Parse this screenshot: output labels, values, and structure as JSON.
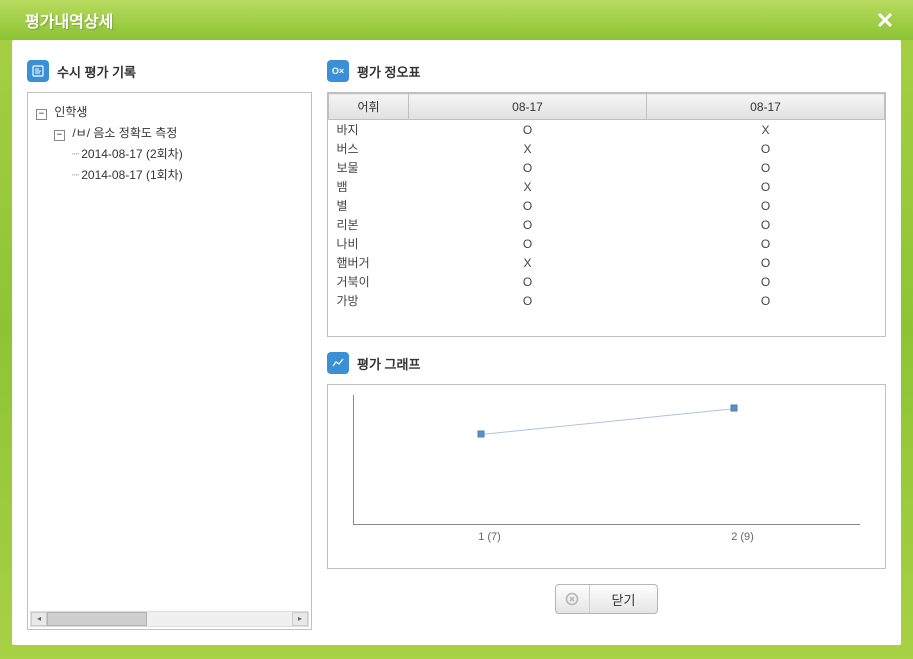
{
  "window": {
    "title": "평가내역상세"
  },
  "left": {
    "header": "수시 평가 기록",
    "tree": {
      "root_label": "인학생",
      "child_label": "/ㅂ/ 음소 정확도 측정",
      "leaves": [
        "2014-08-17 (2회차)",
        "2014-08-17 (1회차)"
      ]
    }
  },
  "right": {
    "table_header": "평가 정오표",
    "table": {
      "col0": "어휘",
      "col1": "08-17",
      "col2": "08-17",
      "rows": [
        {
          "w": "바지",
          "c1": "O",
          "c2": "X"
        },
        {
          "w": "버스",
          "c1": "X",
          "c2": "O"
        },
        {
          "w": "보물",
          "c1": "O",
          "c2": "O"
        },
        {
          "w": "뱀",
          "c1": "X",
          "c2": "O"
        },
        {
          "w": "별",
          "c1": "O",
          "c2": "O"
        },
        {
          "w": "리본",
          "c1": "O",
          "c2": "O"
        },
        {
          "w": "나비",
          "c1": "O",
          "c2": "O"
        },
        {
          "w": "햄버거",
          "c1": "X",
          "c2": "O"
        },
        {
          "w": "거북이",
          "c1": "O",
          "c2": "O"
        },
        {
          "w": "가방",
          "c1": "O",
          "c2": "O"
        }
      ]
    },
    "graph_header": "평가 그래프",
    "chart_data": {
      "type": "line",
      "categories": [
        "1 (7)",
        "2 (9)"
      ],
      "values": [
        7,
        9
      ],
      "ylim": [
        0,
        10
      ],
      "xlabel": "",
      "ylabel": "",
      "title": ""
    }
  },
  "buttons": {
    "close": "닫기"
  }
}
